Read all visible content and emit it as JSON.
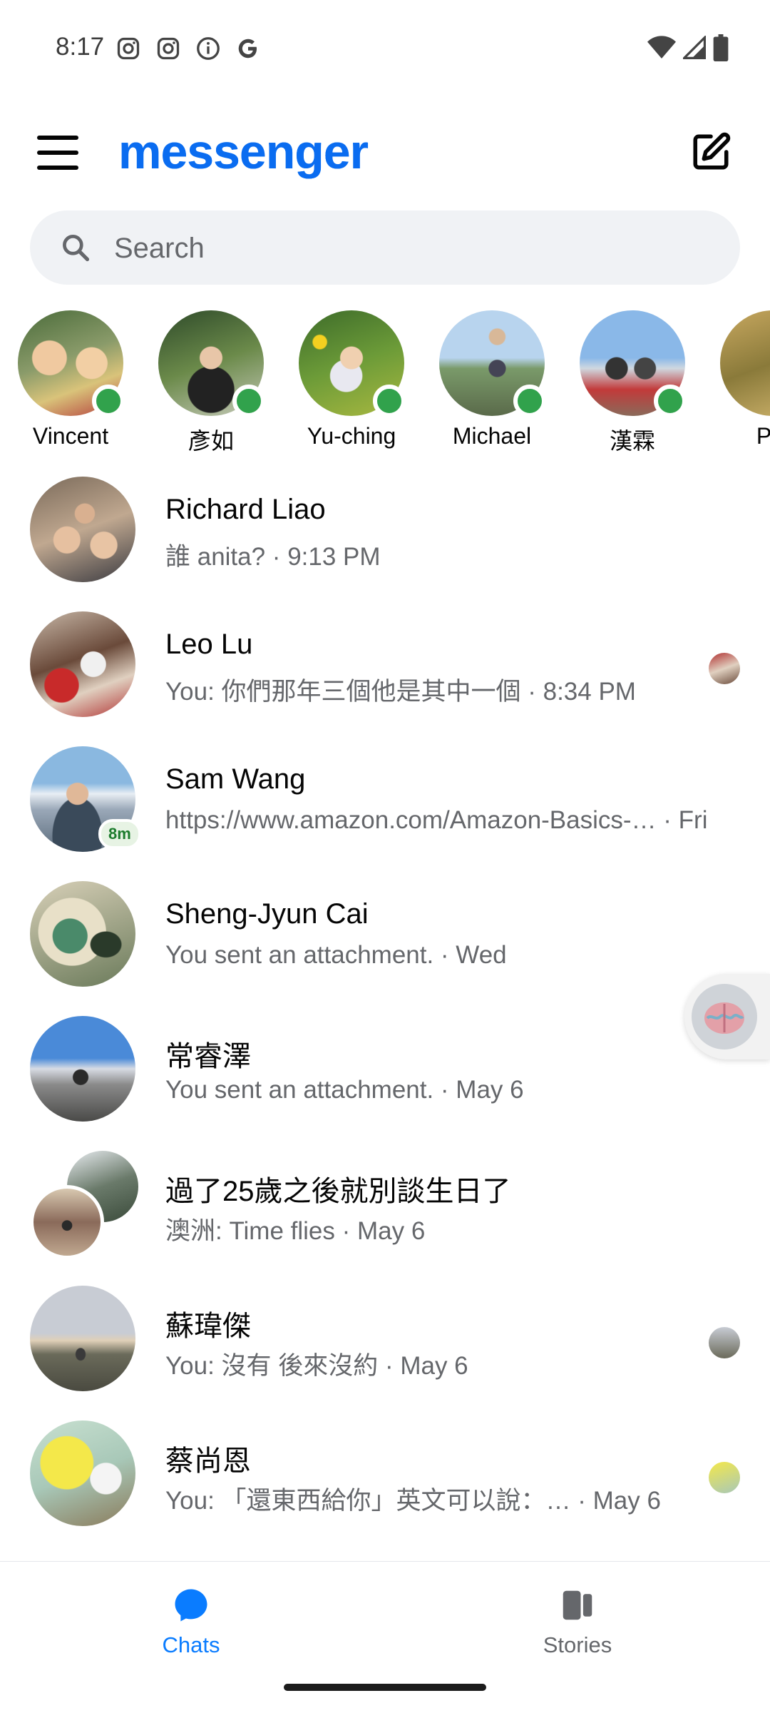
{
  "status_bar": {
    "time": "8:17"
  },
  "header": {
    "title": "messenger"
  },
  "search": {
    "placeholder": "Search"
  },
  "active_contacts": [
    {
      "name": "Vincent",
      "online": true
    },
    {
      "name": "彥如",
      "online": true
    },
    {
      "name": "Yu-ching",
      "online": true
    },
    {
      "name": "Michael",
      "online": true
    },
    {
      "name": "漢霖",
      "online": true
    },
    {
      "name": "Pin",
      "online": false
    }
  ],
  "chats": [
    {
      "name": "Richard Liao",
      "preview": "誰 anita? · 9:13 PM"
    },
    {
      "name": "Leo Lu",
      "preview": "You: 你們那年三個他是其中一個 · 8:34 PM"
    },
    {
      "name": "Sam Wang",
      "preview": "https://www.amazon.com/Amazon-Basics-…  · Fri",
      "badge": "8m"
    },
    {
      "name": "Sheng-Jyun Cai",
      "preview": "You sent an attachment. · Wed"
    },
    {
      "name": "常睿澤",
      "preview": "You sent an attachment. · May 6"
    },
    {
      "name": "過了25歲之後就別談生日了",
      "preview": "澳洲: Time flies · May 6"
    },
    {
      "name": "蘇瑋傑",
      "preview": "You: 沒有 後來沒約 · May 6"
    },
    {
      "name": "蔡尚恩",
      "preview": "You: 「還東西給你」英文可以說：…  · May 6"
    }
  ],
  "bottom_nav": {
    "chats_label": "Chats",
    "stories_label": "Stories"
  },
  "colors": {
    "brand": "#0a7cff",
    "online": "#31a24c",
    "secondary_text": "#65676b"
  }
}
